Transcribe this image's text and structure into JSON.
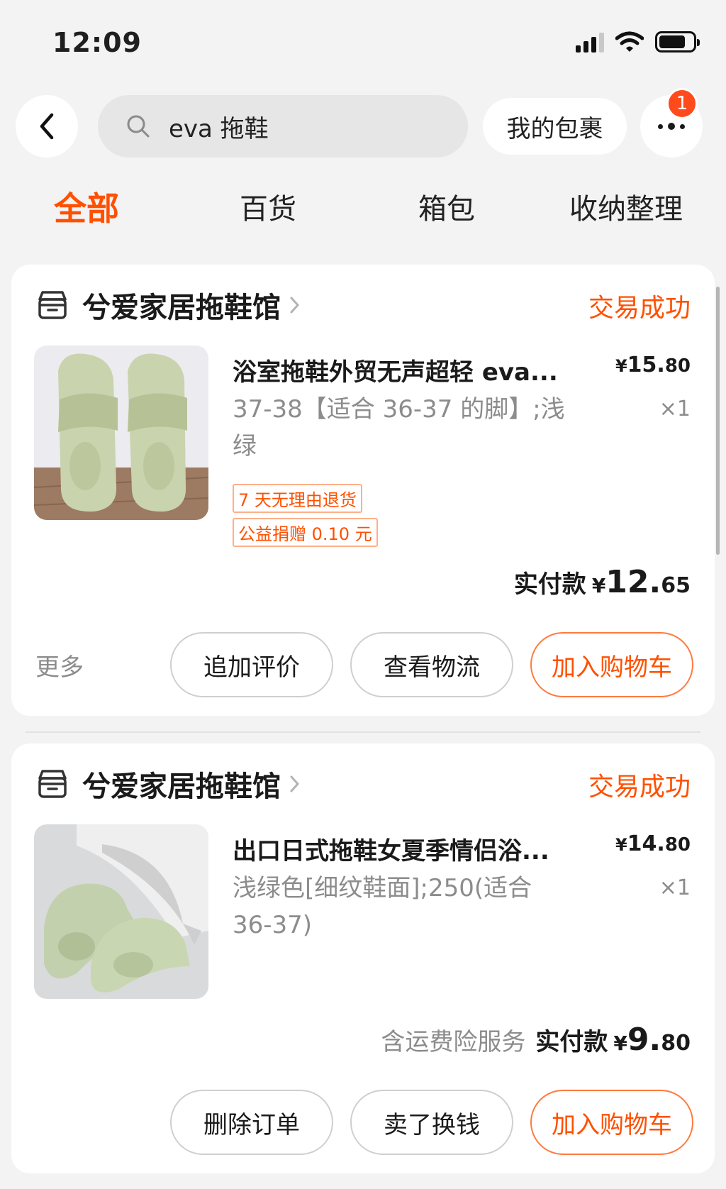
{
  "status_bar": {
    "time": "12:09"
  },
  "header": {
    "search_query": "eva 拖鞋",
    "parcel_label": "我的包裹",
    "badge_count": "1"
  },
  "tabs": [
    {
      "label": "全部",
      "active": true
    },
    {
      "label": "百货"
    },
    {
      "label": "箱包"
    },
    {
      "label": "收纳整理"
    }
  ],
  "orders": [
    {
      "shop": "兮爱家居拖鞋馆",
      "status": "交易成功",
      "title": "浴室拖鞋外贸无声超轻 eva...",
      "price_cur": "¥",
      "price_int": "15.",
      "price_dec": "80",
      "spec_line1": "37-38【适合 36-37 的脚】;浅",
      "spec_line2": "绿",
      "qty": "×1",
      "tags": [
        "7 天无理由退货",
        "公益捐赠 0.10 元"
      ],
      "total_label": "实付款",
      "total_cur": "¥",
      "total_int": "12.",
      "total_dec": "65",
      "more_label": "更多",
      "buttons": [
        "追加评价",
        "查看物流",
        "加入购物车"
      ]
    },
    {
      "shop": "兮爱家居拖鞋馆",
      "status": "交易成功",
      "title": "出口日式拖鞋女夏季情侣浴...",
      "price_cur": "¥",
      "price_int": "14.",
      "price_dec": "80",
      "spec_line1": "浅绿色[细纹鞋面];250(适合",
      "spec_line2": "36-37)",
      "qty": "×1",
      "total_note": "含运费险服务",
      "total_label": "实付款",
      "total_cur": "¥",
      "total_int": "9.",
      "total_dec": "80",
      "buttons": [
        "删除订单",
        "卖了换钱",
        "加入购物车"
      ]
    }
  ],
  "colors": {
    "accent": "#ff5000",
    "badge": "#ff4a1c",
    "background": "#f3f3f3"
  }
}
